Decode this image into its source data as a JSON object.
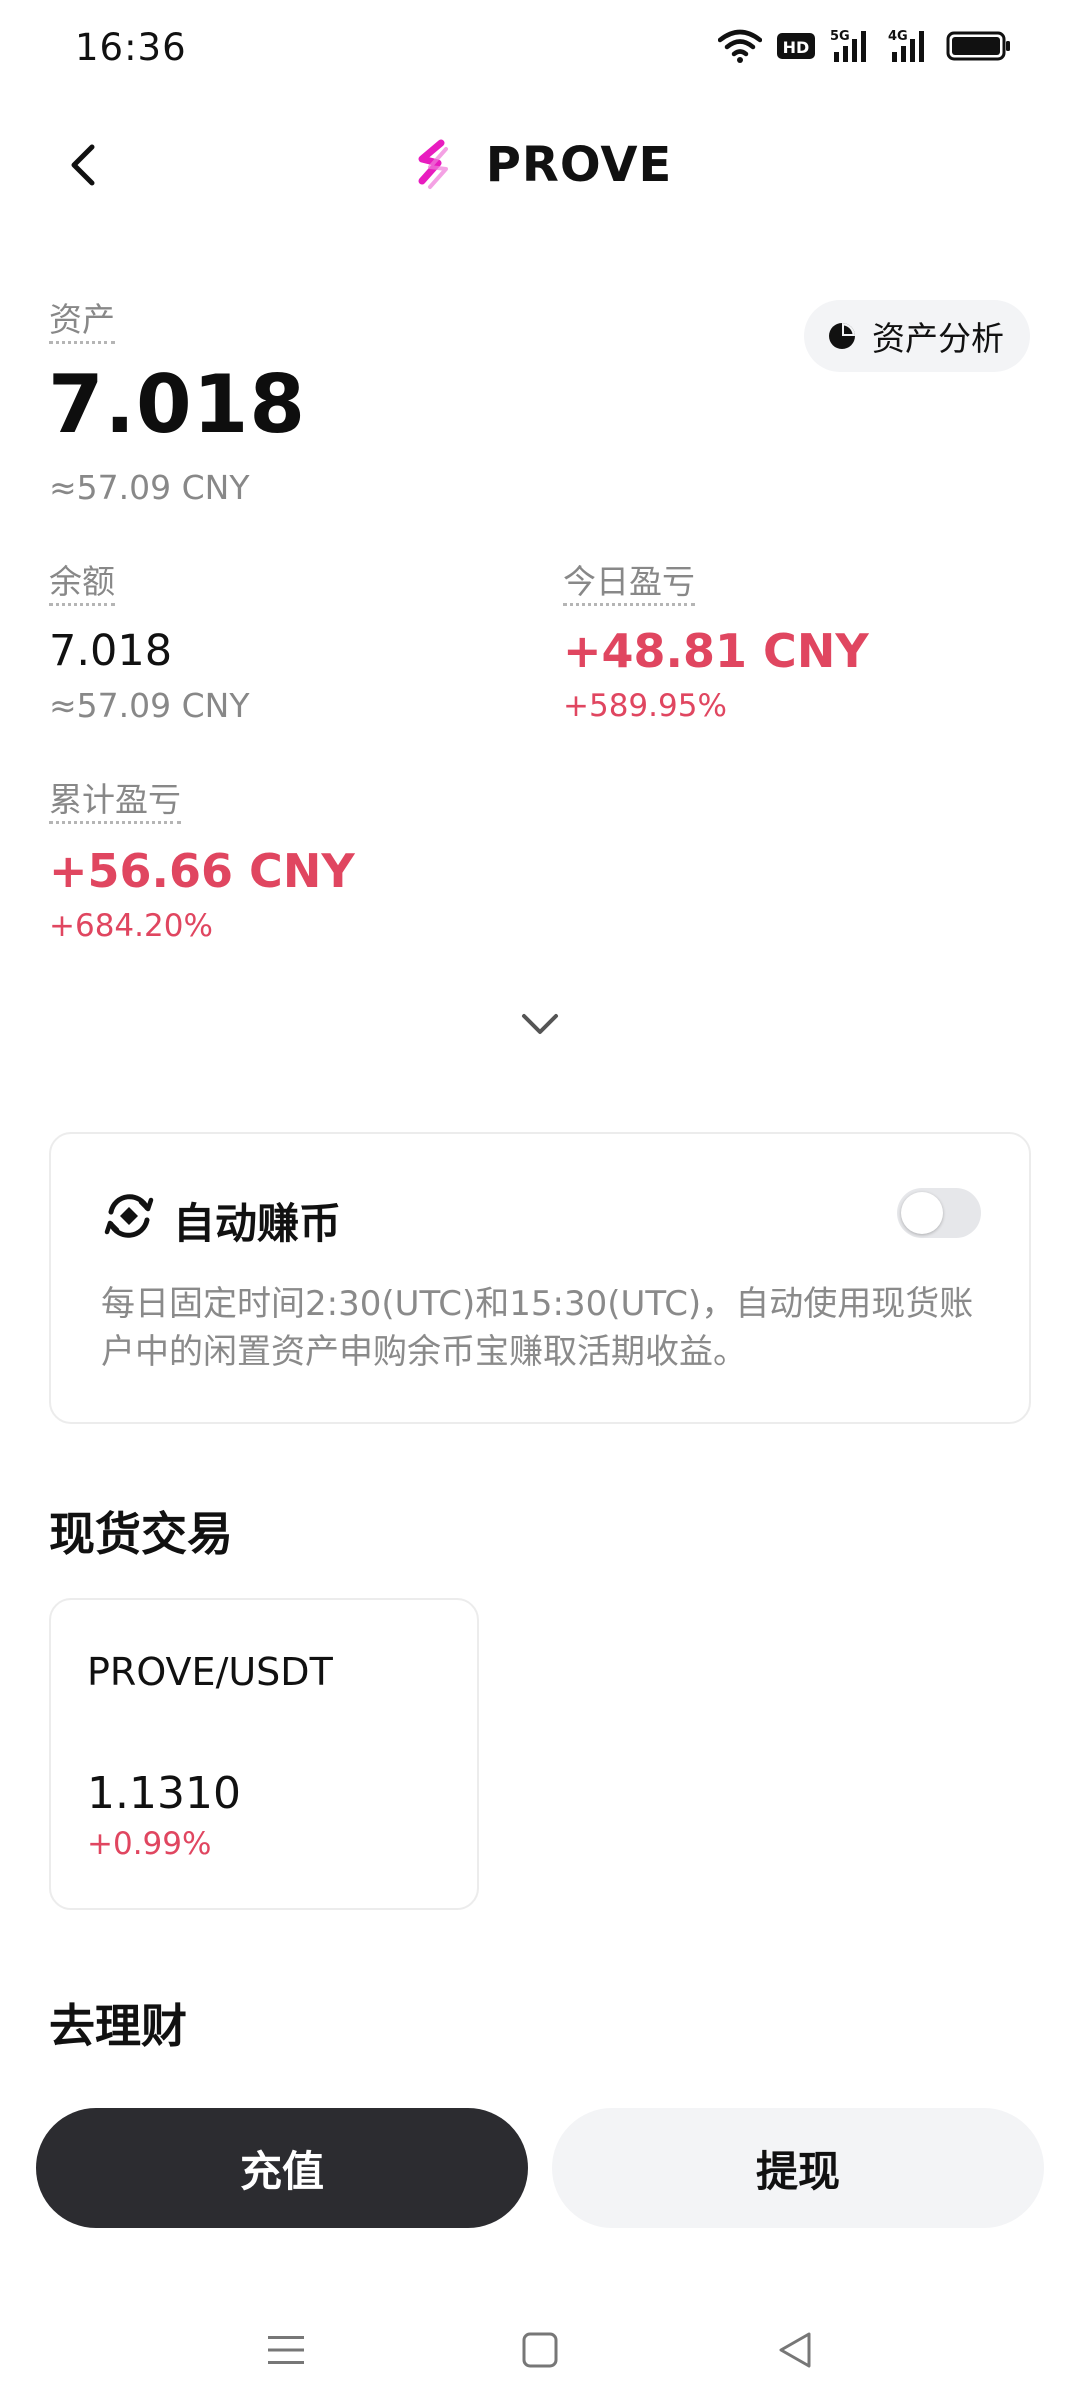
{
  "status_bar": {
    "time": "16:36",
    "icons": [
      "wifi-icon",
      "hd-icon",
      "signal-5g-icon",
      "signal-4g-icon",
      "battery-icon"
    ],
    "hd_label": "HD",
    "net1_label": "5G",
    "net2_label": "4G"
  },
  "header": {
    "title": "PROVE",
    "logo_color": "#e81cbf"
  },
  "assets": {
    "label": "资产",
    "value": "7.018",
    "approx": "≈57.09 CNY",
    "analysis_label": "资产分析"
  },
  "balance": {
    "label": "余额",
    "value": "7.018",
    "approx": "≈57.09 CNY"
  },
  "today_pnl": {
    "label": "今日盈亏",
    "value": "+48.81 CNY",
    "percent": "+589.95%"
  },
  "total_pnl": {
    "label": "累计盈亏",
    "value": "+56.66 CNY",
    "percent": "+684.20%"
  },
  "auto_earn": {
    "title": "自动赚币",
    "enabled": false,
    "description": "每日固定时间2:30(UTC)和15:30(UTC)，自动使用现货账户中的闲置资产申购余币宝赚取活期收益。"
  },
  "spot": {
    "section_title": "现货交易",
    "pair": "PROVE/USDT",
    "price": "1.1310",
    "change": "+0.99%"
  },
  "finance": {
    "section_title": "去理财"
  },
  "actions": {
    "deposit_label": "充值",
    "withdraw_label": "提现"
  },
  "colors": {
    "positive": "#e04660",
    "primary_button": "#2c2c30",
    "secondary_button": "#f3f4f6"
  }
}
